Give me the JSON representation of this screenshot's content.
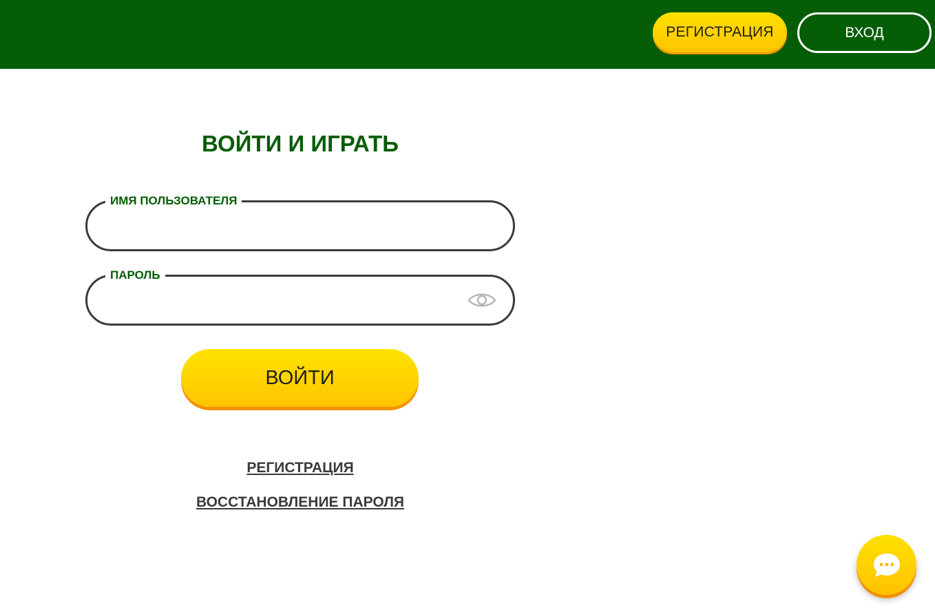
{
  "header": {
    "register_label": "РЕГИСТРАЦИЯ",
    "login_label": "ВХОД"
  },
  "login_form": {
    "title": "ВОЙТИ И ИГРАТЬ",
    "username": {
      "label": "ИМЯ ПОЛЬЗОВАТЕЛЯ",
      "value": "",
      "placeholder": ""
    },
    "password": {
      "label": "ПАРОЛЬ",
      "value": "",
      "placeholder": ""
    },
    "password_toggle_icon": "eye-icon",
    "submit_label": "ВОЙТИ",
    "register_link": "РЕГИСТРАЦИЯ",
    "recover_link": "ВОССТАНОВЛЕНИЕ ПАРОЛЯ"
  },
  "chat": {
    "icon": "chat-bubble-icon"
  },
  "colors": {
    "brand_green": "#055d05",
    "accent_yellow": "#ffd600",
    "accent_orange": "#f29a00",
    "text_dark": "#3a3a3a"
  }
}
